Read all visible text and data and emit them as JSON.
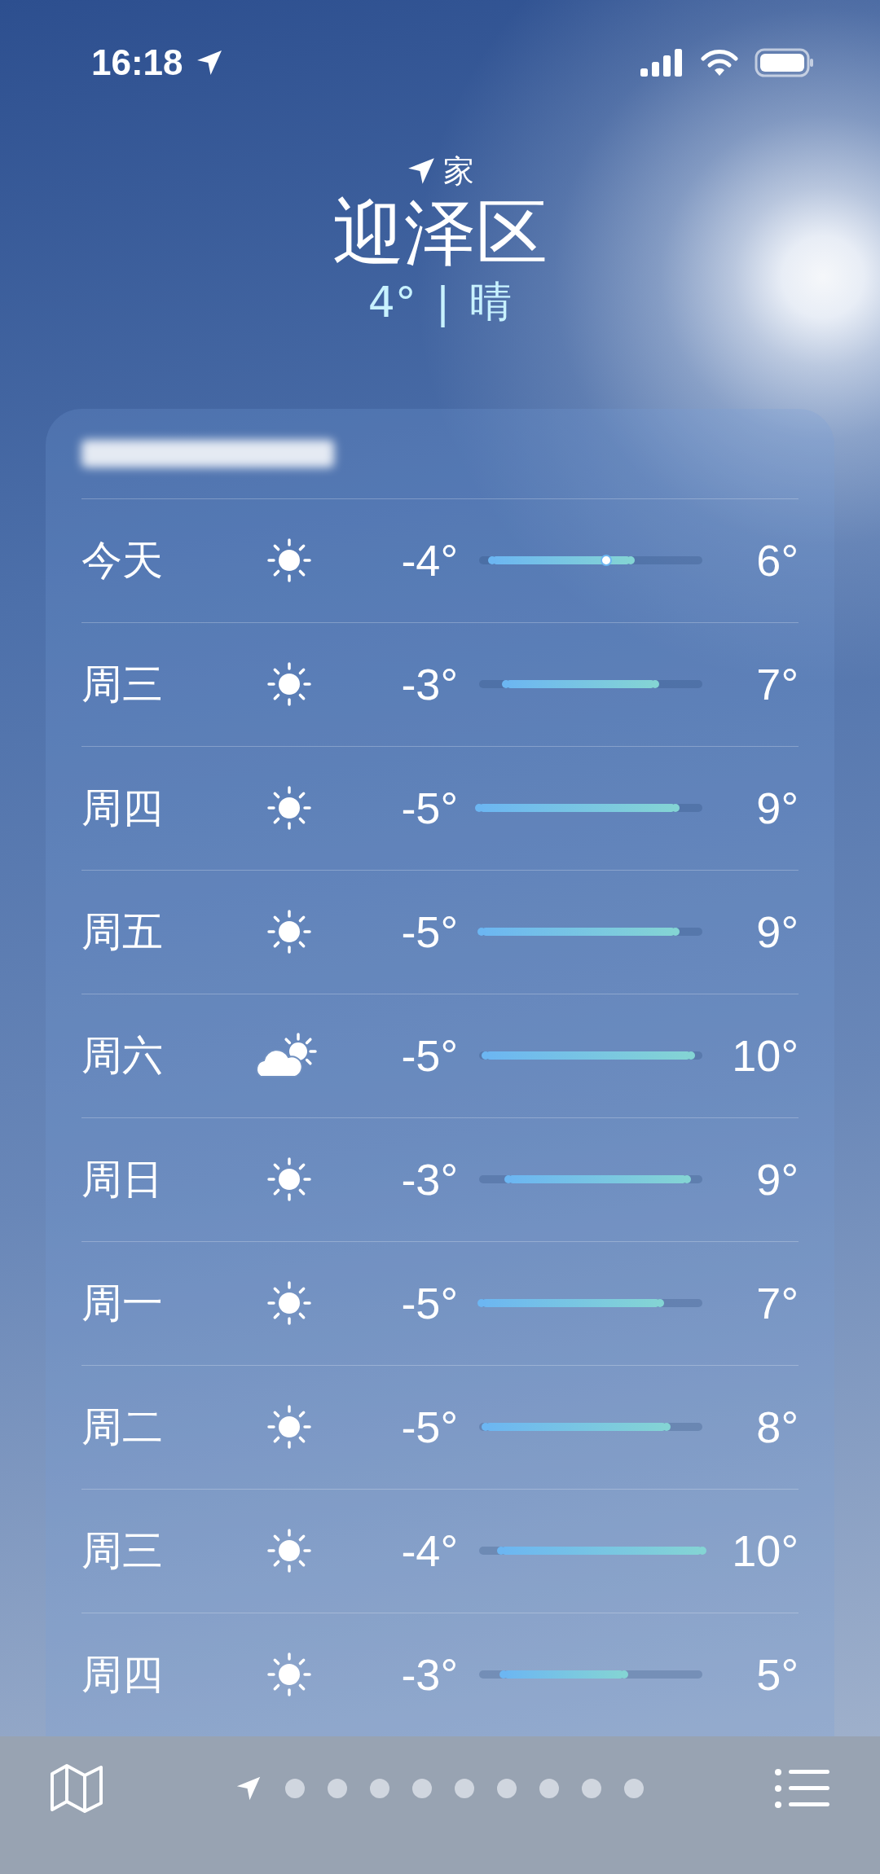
{
  "status_bar": {
    "time": "16:18"
  },
  "header": {
    "location_label": "家",
    "city": "迎泽区",
    "temperature": "4°",
    "separator": "|",
    "condition": "晴"
  },
  "forecast": [
    {
      "day": "今天",
      "kind": "sunny",
      "low": "-4°",
      "high": "6°",
      "bar_start": {
        "level": 0.06
      },
      "bar_end": {
        "level": 0.68
      },
      "current": {
        "level": 0.57
      }
    },
    {
      "day": "周三",
      "kind": "sunny",
      "low": "-3°",
      "high": "7°",
      "bar_start": {
        "level": 0.12
      },
      "bar_end": {
        "level": 0.79
      }
    },
    {
      "day": "周四",
      "kind": "sunny",
      "low": "-5°",
      "high": "9°",
      "bar_start": {
        "level": 0.0
      },
      "bar_end": {
        "level": 0.88
      }
    },
    {
      "day": "周五",
      "kind": "sunny",
      "low": "-5°",
      "high": "9°",
      "bar_start": {
        "level": 0.01
      },
      "bar_end": {
        "level": 0.88
      }
    },
    {
      "day": "周六",
      "kind": "partly-cloudy",
      "low": "-5°",
      "high": "10°",
      "bar_start": {
        "level": 0.03
      },
      "bar_end": {
        "level": 0.95
      }
    },
    {
      "day": "周日",
      "kind": "sunny",
      "low": "-3°",
      "high": "9°",
      "bar_start": {
        "level": 0.13
      },
      "bar_end": {
        "level": 0.93
      }
    },
    {
      "day": "周一",
      "kind": "sunny",
      "low": "-5°",
      "high": "7°",
      "bar_start": {
        "level": 0.01
      },
      "bar_end": {
        "level": 0.81
      }
    },
    {
      "day": "周二",
      "kind": "sunny",
      "low": "-5°",
      "high": "8°",
      "bar_start": {
        "level": 0.03
      },
      "bar_end": {
        "level": 0.84
      }
    },
    {
      "day": "周三",
      "kind": "sunny",
      "low": "-4°",
      "high": "10°",
      "bar_start": {
        "level": 0.1
      },
      "bar_end": {
        "level": 1.0
      }
    },
    {
      "day": "周四",
      "kind": "sunny",
      "low": "-3°",
      "high": "5°",
      "bar_start": {
        "level": 0.11
      },
      "bar_end": {
        "level": 0.65
      }
    }
  ],
  "pages": [
    {
      "kind": "location",
      "selected": true
    },
    {
      "kind": "dot",
      "selected": false
    },
    {
      "kind": "dot",
      "selected": false
    },
    {
      "kind": "dot",
      "selected": false
    },
    {
      "kind": "dot",
      "selected": false
    },
    {
      "kind": "dot",
      "selected": false
    },
    {
      "kind": "dot",
      "selected": false
    },
    {
      "kind": "dot",
      "selected": false
    },
    {
      "kind": "dot",
      "selected": false
    },
    {
      "kind": "dot",
      "selected": false
    }
  ]
}
